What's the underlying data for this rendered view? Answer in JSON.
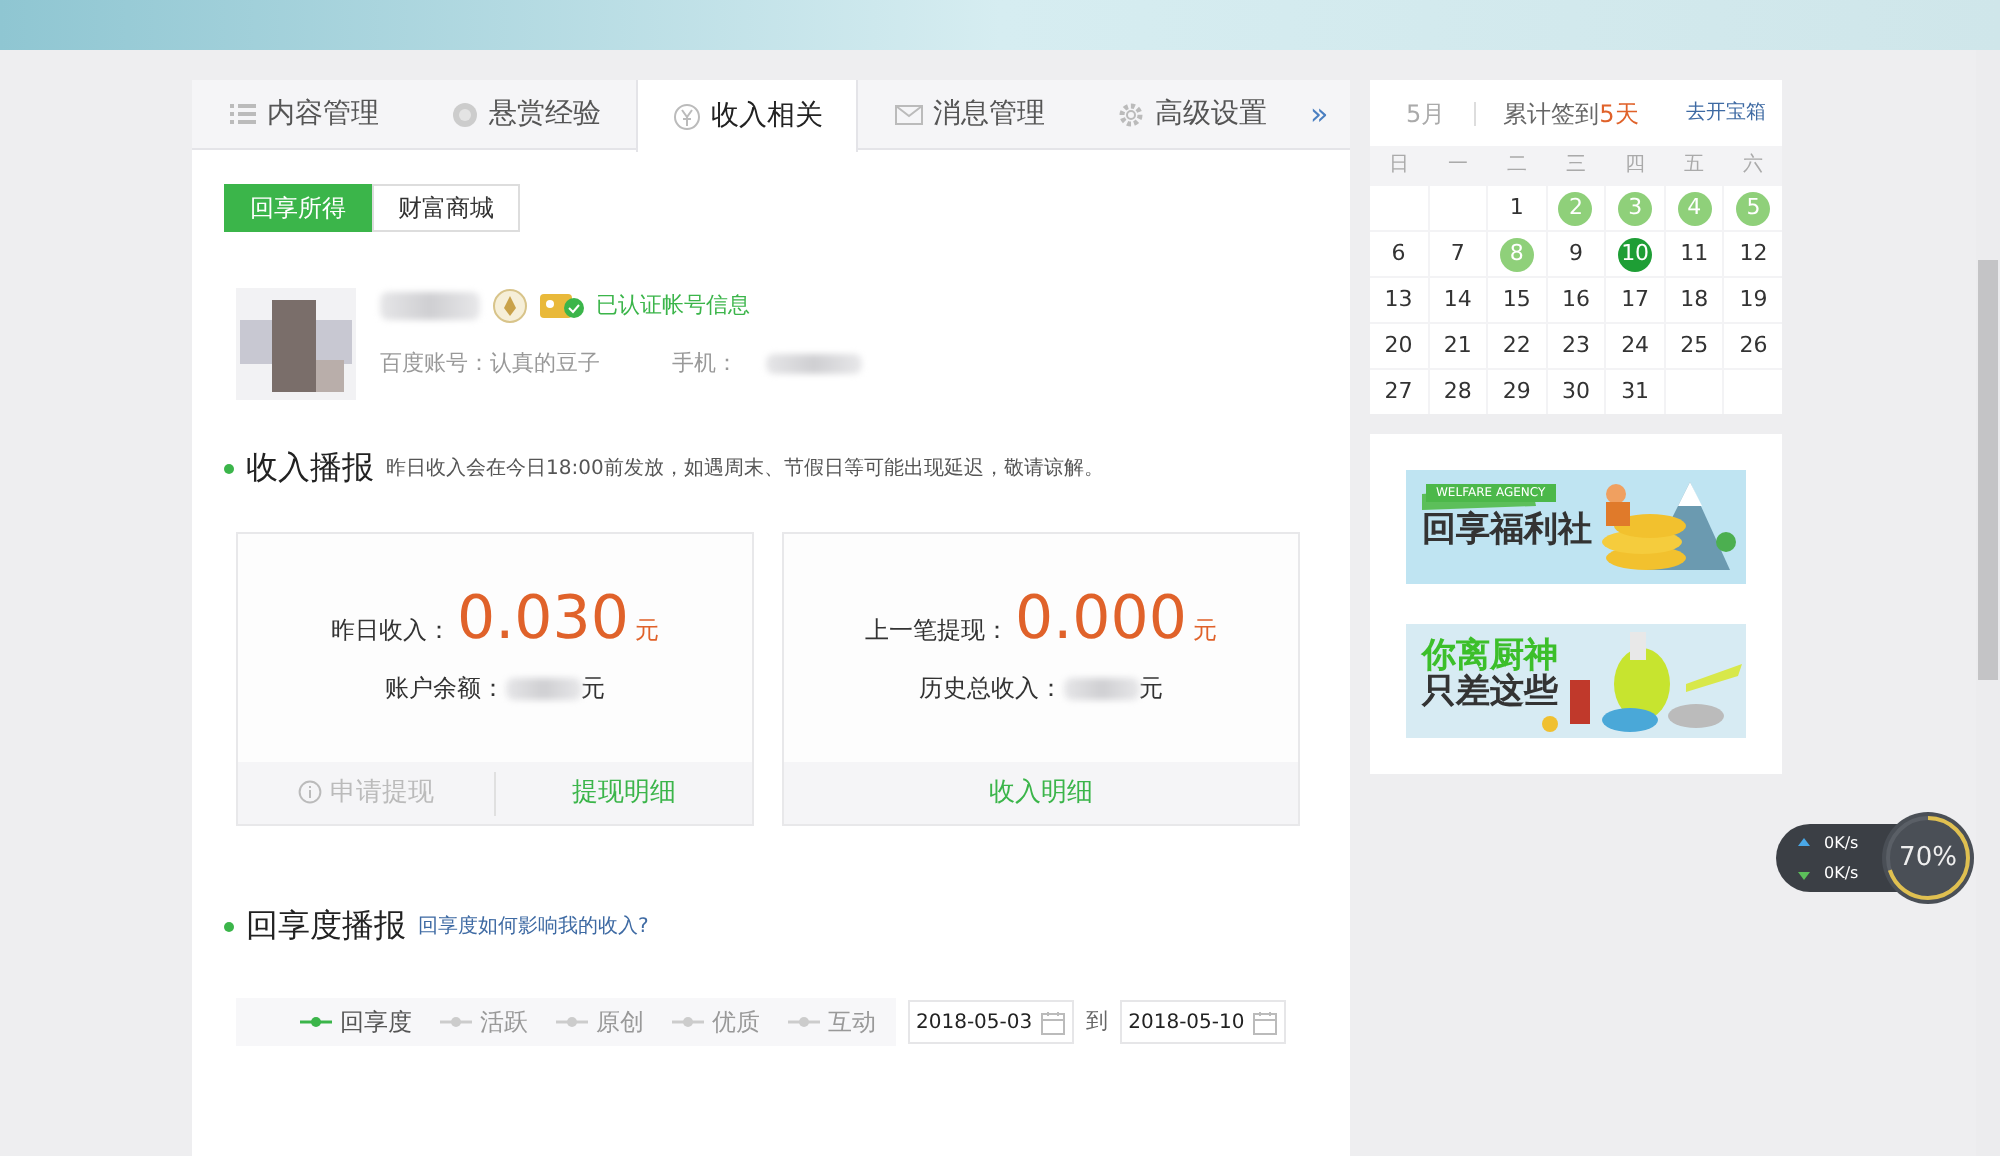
{
  "tabs": [
    {
      "label": "内容管理",
      "selected": false
    },
    {
      "label": "悬赏经验",
      "selected": false
    },
    {
      "label": "收入相关",
      "selected": true
    },
    {
      "label": "消息管理",
      "selected": false
    },
    {
      "label": "高级设置",
      "selected": false
    }
  ],
  "tabs_more": "»",
  "subtabs": [
    {
      "label": "回享所得",
      "selected": true
    },
    {
      "label": "财富商城",
      "selected": false
    }
  ],
  "profile": {
    "verified_text": "已认证帐号信息",
    "account_label": "百度账号：",
    "account_name": "认真的豆子",
    "phone_label": "手机："
  },
  "income_section": {
    "title": "收入播报",
    "note": "昨日收入会在今日18:00前发放，如遇周末、节假日等可能出现延迟，敬请谅解。"
  },
  "income_cards": [
    {
      "label": "昨日收入：",
      "amount": "0.030",
      "unit": "元",
      "sub_label": "账户余额：",
      "sub_unit": "元",
      "actions": [
        {
          "label": "申请提现",
          "disabled": true
        },
        {
          "label": "提现明细",
          "disabled": false
        }
      ]
    },
    {
      "label": "上一笔提现：",
      "amount": "0.000",
      "unit": "元",
      "sub_label": "历史总收入：",
      "sub_unit": "元",
      "actions": [
        {
          "label": "收入明细",
          "disabled": false
        }
      ]
    }
  ],
  "share_section": {
    "title": "回享度播报",
    "link": "回享度如何影响我的收入?"
  },
  "metrics": [
    {
      "label": "回享度",
      "selected": true
    },
    {
      "label": "活跃",
      "selected": false
    },
    {
      "label": "原创",
      "selected": false
    },
    {
      "label": "优质",
      "selected": false
    },
    {
      "label": "互动",
      "selected": false
    }
  ],
  "date_range": {
    "from": "2018-05-03",
    "separator": "到",
    "to": "2018-05-10"
  },
  "calendar": {
    "month": "5月",
    "signin_label": "累计签到",
    "signin_days": "5天",
    "chest_link": "去开宝箱",
    "weekdays": [
      "日",
      "一",
      "二",
      "三",
      "四",
      "五",
      "六"
    ],
    "weeks": [
      [
        {
          "day": "1",
          "signed": false,
          "today": false
        },
        {
          "day": "2",
          "signed": true,
          "today": false
        },
        {
          "day": "3",
          "signed": true,
          "today": false
        },
        {
          "day": "4",
          "signed": true,
          "today": false
        },
        {
          "day": "5",
          "signed": true,
          "today": false
        }
      ],
      [
        {
          "day": "6",
          "signed": false,
          "today": false
        },
        {
          "day": "7",
          "signed": false,
          "today": false
        },
        {
          "day": "8",
          "signed": true,
          "today": false
        },
        {
          "day": "9",
          "signed": false,
          "today": false
        },
        {
          "day": "10",
          "signed": true,
          "today": true
        },
        {
          "day": "11",
          "signed": false,
          "today": false
        },
        {
          "day": "12",
          "signed": false,
          "today": false
        }
      ],
      [
        {
          "day": "13",
          "signed": false,
          "today": false
        },
        {
          "day": "14",
          "signed": false,
          "today": false
        },
        {
          "day": "15",
          "signed": false,
          "today": false
        },
        {
          "day": "16",
          "signed": false,
          "today": false
        },
        {
          "day": "17",
          "signed": false,
          "today": false
        },
        {
          "day": "18",
          "signed": false,
          "today": false
        },
        {
          "day": "19",
          "signed": false,
          "today": false
        }
      ],
      [
        {
          "day": "20",
          "signed": false,
          "today": false
        },
        {
          "day": "21",
          "signed": false,
          "today": false
        },
        {
          "day": "22",
          "signed": false,
          "today": false
        },
        {
          "day": "23",
          "signed": false,
          "today": false
        },
        {
          "day": "24",
          "signed": false,
          "today": false
        },
        {
          "day": "25",
          "signed": false,
          "today": false
        },
        {
          "day": "26",
          "signed": false,
          "today": false
        }
      ],
      [
        {
          "day": "27",
          "signed": false,
          "today": false
        },
        {
          "day": "28",
          "signed": false,
          "today": false
        },
        {
          "day": "29",
          "signed": false,
          "today": false
        },
        {
          "day": "30",
          "signed": false,
          "today": false
        },
        {
          "day": "31",
          "signed": false,
          "today": false
        }
      ]
    ]
  },
  "banners": [
    {
      "kind": "welfare",
      "lines": [
        "回享福利社"
      ],
      "tag": "WELFARE AGENCY"
    },
    {
      "kind": "kitchen",
      "lines": [
        "你离厨神",
        "只差这些"
      ]
    }
  ],
  "net_meter": {
    "upload": "0K/s",
    "download": "0K/s",
    "percent": "70%"
  }
}
